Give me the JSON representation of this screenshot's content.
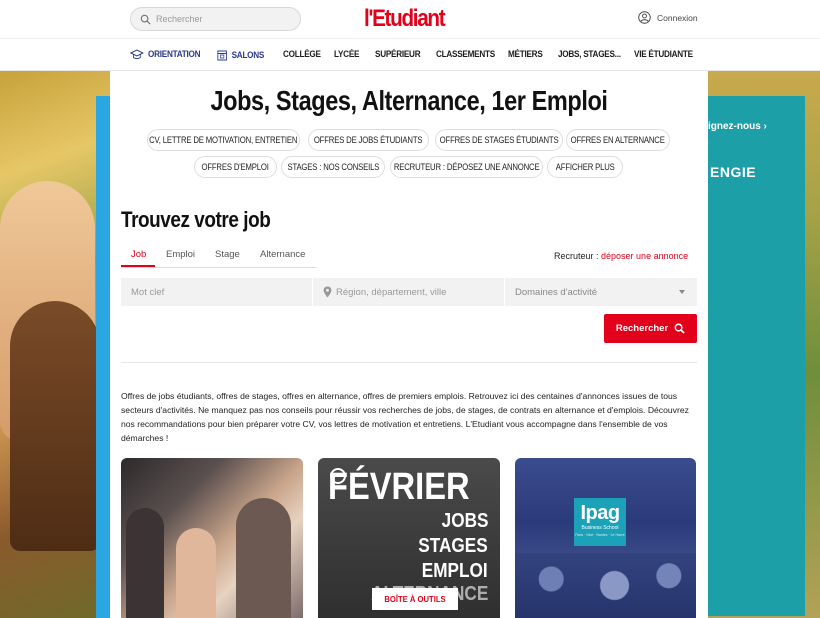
{
  "header": {
    "search_placeholder": "Rechercher",
    "logo_text": "l'Etudiant",
    "login_label": "Connexion"
  },
  "nav": {
    "items": [
      {
        "label": "ORIENTATION",
        "icon": "graduation-cap-icon"
      },
      {
        "label": "SALONS",
        "icon": "calendar-icon"
      },
      {
        "label": "COLLÈGE"
      },
      {
        "label": "LYCÉE"
      },
      {
        "label": "SUPÉRIEUR"
      },
      {
        "label": "CLASSEMENTS"
      },
      {
        "label": "MÉTIERS"
      },
      {
        "label": "JOBS, STAGES..."
      },
      {
        "label": "VIE ÉTUDIANTE"
      }
    ]
  },
  "ad": {
    "cta": "ignez-nous ›",
    "brand": "ENGIE"
  },
  "main": {
    "title": "Jobs, Stages, Alternance, 1er Emploi",
    "chips": [
      "CV, LETTRE DE MOTIVATION, ENTRETIEN",
      "OFFRES DE JOBS ÉTUDIANTS",
      "OFFRES DE STAGES ÉTUDIANTS",
      "OFFRES EN ALTERNANCE",
      "OFFRES D'EMPLOI",
      "STAGES : NOS CONSEILS",
      "RECRUTEUR : DÉPOSEZ UNE ANNONCE",
      "AFFICHER PLUS"
    ],
    "find_title": "Trouvez votre job",
    "tabs": [
      "Job",
      "Emploi",
      "Stage",
      "Alternance"
    ],
    "active_tab": "Job",
    "recruiter_prefix": "Recruteur : ",
    "recruiter_link": "déposer une annonce",
    "fields": {
      "keyword_placeholder": "Mot clef",
      "location_placeholder": "Région, département, ville",
      "domain_value": "Domaines d'activité"
    },
    "search_button": "Rechercher",
    "intro": "Offres de jobs étudiants, offres de stages, offres en alternance, offres de premiers emplois. Retrouvez ici des centaines d'annonces issues de tous secteurs d'activités. Ne manquez pas nos conseils pour réussir vos recherches de jobs, de stages, de contrats en alternance et d'emplois. Découvrez nos recommandations pour bien préparer votre CV, vos lettres de motivation et entretiens. L'Etudiant vous accompagne dans l'ensemble de vos démarches !",
    "cards": {
      "card2_big": "FÉVRIER",
      "card2_lines": [
        "JOBS",
        "STAGES",
        "EMPLOI",
        "ALTERNANCE"
      ],
      "card2_badge": "BOÎTE À OUTILS",
      "card3_logo": "Ipag",
      "card3_sub": "Business School",
      "card3_tiny": "Paris · Nice · Nantes · Le Havre"
    }
  },
  "colors": {
    "brand_red": "#e2001a",
    "nav_blue": "#2b3a8c",
    "ad_teal": "#1d9fa8"
  }
}
